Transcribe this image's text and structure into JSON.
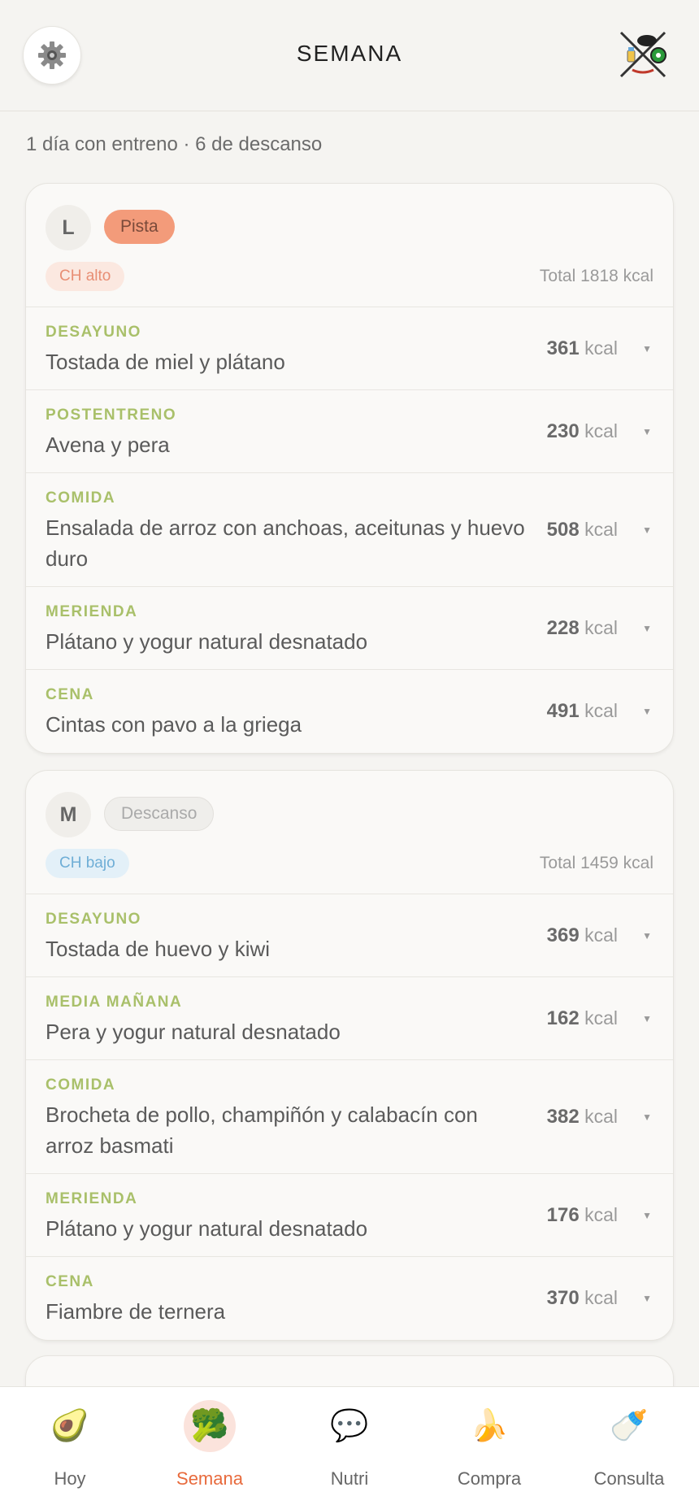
{
  "header": {
    "title": "SEMANA",
    "settings_icon": "gear-icon",
    "logo_icon": "app-logo"
  },
  "summary": "1 día con entreno · 6 de descanso",
  "days": [
    {
      "letter": "L",
      "session": "Pista",
      "carbs": "CH alto",
      "total": "Total 1818 kcal",
      "meals": [
        {
          "type": "DESAYUNO",
          "name": "Tostada de miel y plátano",
          "kcal": "361",
          "unit": "kcal"
        },
        {
          "type": "POSTENTRENO",
          "name": "Avena y pera",
          "kcal": "230",
          "unit": "kcal"
        },
        {
          "type": "COMIDA",
          "name": "Ensalada de arroz con anchoas, aceitunas y huevo duro",
          "kcal": "508",
          "unit": "kcal"
        },
        {
          "type": "MERIENDA",
          "name": "Plátano y yogur natural desnatado",
          "kcal": "228",
          "unit": "kcal"
        },
        {
          "type": "CENA",
          "name": "Cintas con pavo a la griega",
          "kcal": "491",
          "unit": "kcal"
        }
      ]
    },
    {
      "letter": "M",
      "session": "Descanso",
      "carbs": "CH bajo",
      "total": "Total 1459 kcal",
      "meals": [
        {
          "type": "DESAYUNO",
          "name": "Tostada de huevo y kiwi",
          "kcal": "369",
          "unit": "kcal"
        },
        {
          "type": "MEDIA MAÑANA",
          "name": "Pera y yogur natural desnatado",
          "kcal": "162",
          "unit": "kcal"
        },
        {
          "type": "COMIDA",
          "name": "Brocheta de pollo, champiñón y calabacín con arroz basmati",
          "kcal": "382",
          "unit": "kcal"
        },
        {
          "type": "MERIENDA",
          "name": "Plátano y yogur natural desnatado",
          "kcal": "176",
          "unit": "kcal"
        },
        {
          "type": "CENA",
          "name": "Fiambre de ternera",
          "kcal": "370",
          "unit": "kcal"
        }
      ]
    }
  ],
  "tabs": [
    {
      "label": "Hoy",
      "icon": "avocado-icon",
      "glyph": "🥑"
    },
    {
      "label": "Semana",
      "icon": "broccoli-icon",
      "glyph": "🥦"
    },
    {
      "label": "Nutri",
      "icon": "chat-bubble-icon",
      "glyph": "💬"
    },
    {
      "label": "Compra",
      "icon": "banana-icon",
      "glyph": "🍌"
    },
    {
      "label": "Consulta",
      "icon": "milk-bottle-icon",
      "glyph": "🍼"
    }
  ],
  "colors": {
    "accent": "#e86a3c",
    "meal_type": "#a9c06a",
    "chip_pista": "#f39b7a",
    "ch_alto": "#e88e74",
    "ch_bajo": "#6faed6"
  }
}
